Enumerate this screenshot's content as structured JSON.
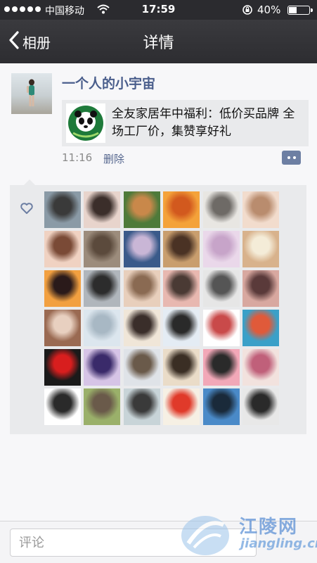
{
  "status_bar": {
    "carrier": "中国移动",
    "time": "17:59",
    "battery_percent": "40%",
    "battery_level": 0.4,
    "icons": [
      "signal-dots-icon",
      "wifi-icon",
      "rotation-lock-icon",
      "battery-icon"
    ]
  },
  "nav": {
    "back_label": "相册",
    "title": "详情",
    "back_icon": "chevron-left-icon"
  },
  "post": {
    "username": "一个人的小宇宙",
    "share_title": "全友家居年中福利：低价买品牌 全场工厂价，集赞享好礼",
    "time": "11:16",
    "delete_label": "删除",
    "comment_icon": "comment-dots-icon"
  },
  "likes": {
    "icon": "heart-outline-icon",
    "accent": "#6d7fa3"
  },
  "avatars": [
    {
      "c1": "#8a9aa6",
      "c2": "#3a3a3a"
    },
    {
      "c1": "#e8d4cc",
      "c2": "#3b2e2a"
    },
    {
      "c1": "#4e7a3a",
      "c2": "#c9884a"
    },
    {
      "c1": "#f4a23a",
      "c2": "#d2591e"
    },
    {
      "c1": "#e8e6e2",
      "c2": "#6e6a66"
    },
    {
      "c1": "#f2dccd",
      "c2": "#b98c6e"
    },
    {
      "c1": "#f0d2c2",
      "c2": "#7a4a36"
    },
    {
      "c1": "#9c8c7c",
      "c2": "#5b4a3c"
    },
    {
      "c1": "#3a5a8a",
      "c2": "#c9b6d6"
    },
    {
      "c1": "#c99e6e",
      "c2": "#4a3224"
    },
    {
      "c1": "#ead8ea",
      "c2": "#c7a4c9"
    },
    {
      "c1": "#d8b28c",
      "c2": "#f4ecd8"
    },
    {
      "c1": "#f2a040",
      "c2": "#2a1a1a"
    },
    {
      "c1": "#b0b6bc",
      "c2": "#2c2c2c"
    },
    {
      "c1": "#e8cfbc",
      "c2": "#8a6a52"
    },
    {
      "c1": "#e8b8b0",
      "c2": "#4a3a34"
    },
    {
      "c1": "#e6e6e6",
      "c2": "#555555"
    },
    {
      "c1": "#d8a8a0",
      "c2": "#5a3a3a"
    },
    {
      "c1": "#9a6a52",
      "c2": "#e8d0c0"
    },
    {
      "c1": "#dce6ee",
      "c2": "#a8b8c4"
    },
    {
      "c1": "#f0e6d8",
      "c2": "#3a2e2a"
    },
    {
      "c1": "#e4ecf4",
      "c2": "#2a2a2a"
    },
    {
      "c1": "#ffffff",
      "c2": "#c94a4a"
    },
    {
      "c1": "#3aa0c8",
      "c2": "#e05a3a"
    },
    {
      "c1": "#1a1a1a",
      "c2": "#d81e1e"
    },
    {
      "c1": "#d6c4e6",
      "c2": "#3a2a6a"
    },
    {
      "c1": "#dfe3e8",
      "c2": "#6a5a4a"
    },
    {
      "c1": "#eadcc8",
      "c2": "#3a2e24"
    },
    {
      "c1": "#f2a8b8",
      "c2": "#2a2a2a"
    },
    {
      "c1": "#f2e2de",
      "c2": "#c0607a"
    },
    {
      "c1": "#ffffff",
      "c2": "#2a2a2a"
    },
    {
      "c1": "#9ab06a",
      "c2": "#6a5a4a"
    },
    {
      "c1": "#c8d4d8",
      "c2": "#3a3a3a"
    },
    {
      "c1": "#f6f0e4",
      "c2": "#e03a2a"
    },
    {
      "c1": "#4a8ac8",
      "c2": "#1a2a3a"
    },
    {
      "c1": "#e8e8e8",
      "c2": "#2a2a2a"
    }
  ],
  "bottom_bar": {
    "comment_placeholder": "评论"
  },
  "watermark": {
    "brand": "江陵网",
    "url": "jiangling.cn"
  }
}
